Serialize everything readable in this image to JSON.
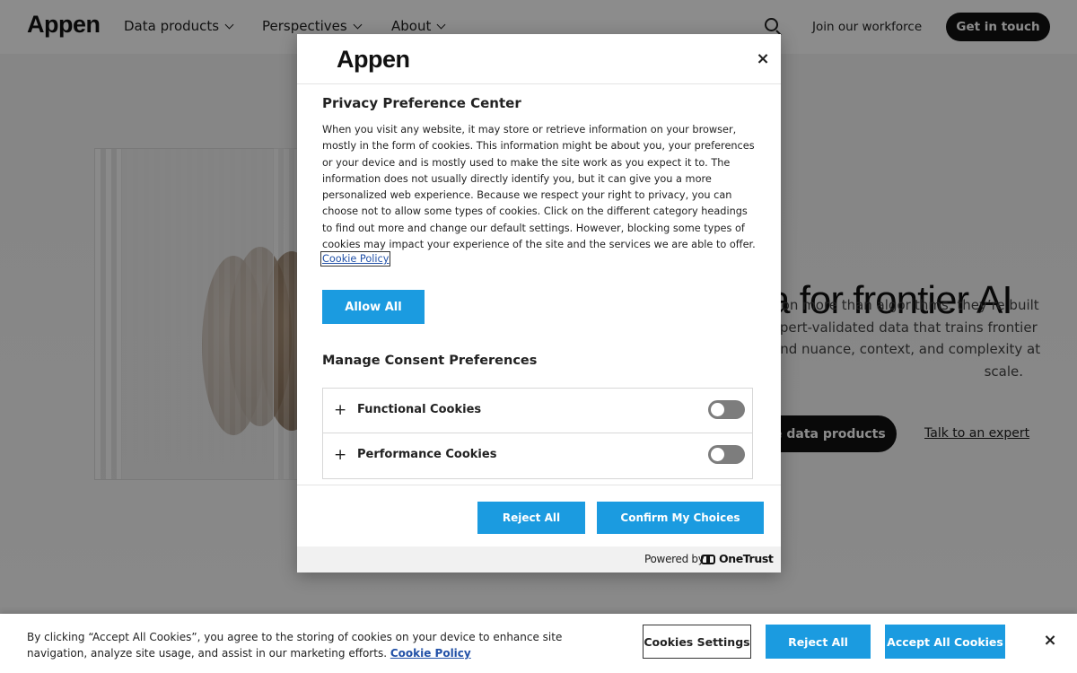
{
  "site": {
    "logo": "Appen",
    "nav": [
      "Data products",
      "Perspectives",
      "About"
    ],
    "join_link": "Join our workforce",
    "contact_button": "Get in touch"
  },
  "hero": {
    "title_partial": "a for frontier AI",
    "copy_lines": [
      "t on more than algorithms, they’re built",
      "xpert-validated data that trains frontier",
      "and nuance, context, and complexity at",
      "scale."
    ],
    "primary_button_partial": "e data products",
    "secondary_link": "Talk to an expert"
  },
  "modal": {
    "logo": "Appen",
    "close_label": "×",
    "title": "Privacy Preference Center",
    "description": "When you visit any website, it may store or retrieve information on your browser, mostly in the form of cookies. This information might be about you, your preferences or your device and is mostly used to make the site work as you expect it to. The information does not usually directly identify you, but it can give you a more personalized web experience. Because we respect your right to privacy, you can choose not to allow some types of cookies. Click on the different category headings to find out more and change our default settings. However, blocking some types of cookies may impact your experience of the site and the services we are able to offer.",
    "policy_link": "Cookie Policy",
    "allow_all": "Allow All",
    "manage_title": "Manage Consent Preferences",
    "categories": [
      {
        "label": "Functional Cookies",
        "enabled": false
      },
      {
        "label": "Performance Cookies",
        "enabled": false
      }
    ],
    "reject_all": "Reject All",
    "confirm": "Confirm My Choices",
    "powered_by": "Powered by",
    "vendor": "OneTrust"
  },
  "banner": {
    "text": "By clicking “Accept All Cookies”, you agree to the storing of cookies on your device to enhance site navigation, analyze site usage, and assist in our marketing efforts.",
    "policy_link": "Cookie Policy",
    "settings_button": "Cookies Settings",
    "reject_button": "Reject All",
    "accept_button": "Accept All Cookies",
    "close_label": "×"
  },
  "colors": {
    "accent": "#1b9be0",
    "link": "#2251a7",
    "overlay": "rgba(0,0,0,0.45)"
  }
}
